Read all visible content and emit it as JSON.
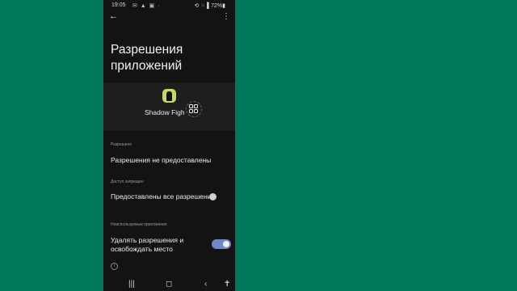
{
  "status": {
    "time": "19:05",
    "icons": "✉ ▲ ▣ ·",
    "right": "⟲ ⁙ ▌72%▮"
  },
  "header": {
    "back": "←",
    "menu": "⋮"
  },
  "title": "Разрешения приложений",
  "app": {
    "name": "Shadow Figh"
  },
  "sections": [
    {
      "label": "Разрешено",
      "items": [
        "Разрешения не предоставлены"
      ]
    },
    {
      "label": "Доступ запрещен",
      "items": [
        "Предоставлены все разрешения"
      ]
    },
    {
      "label": "Неиспользуемые приложения",
      "items": [
        "Удалять разрешения и освобождать место"
      ]
    }
  ],
  "toggle": {
    "on": true,
    "accent": "#6f86c8"
  },
  "navbar": {
    "recents": "|||",
    "home": "◻",
    "back": "‹",
    "accessibility": "✝"
  }
}
